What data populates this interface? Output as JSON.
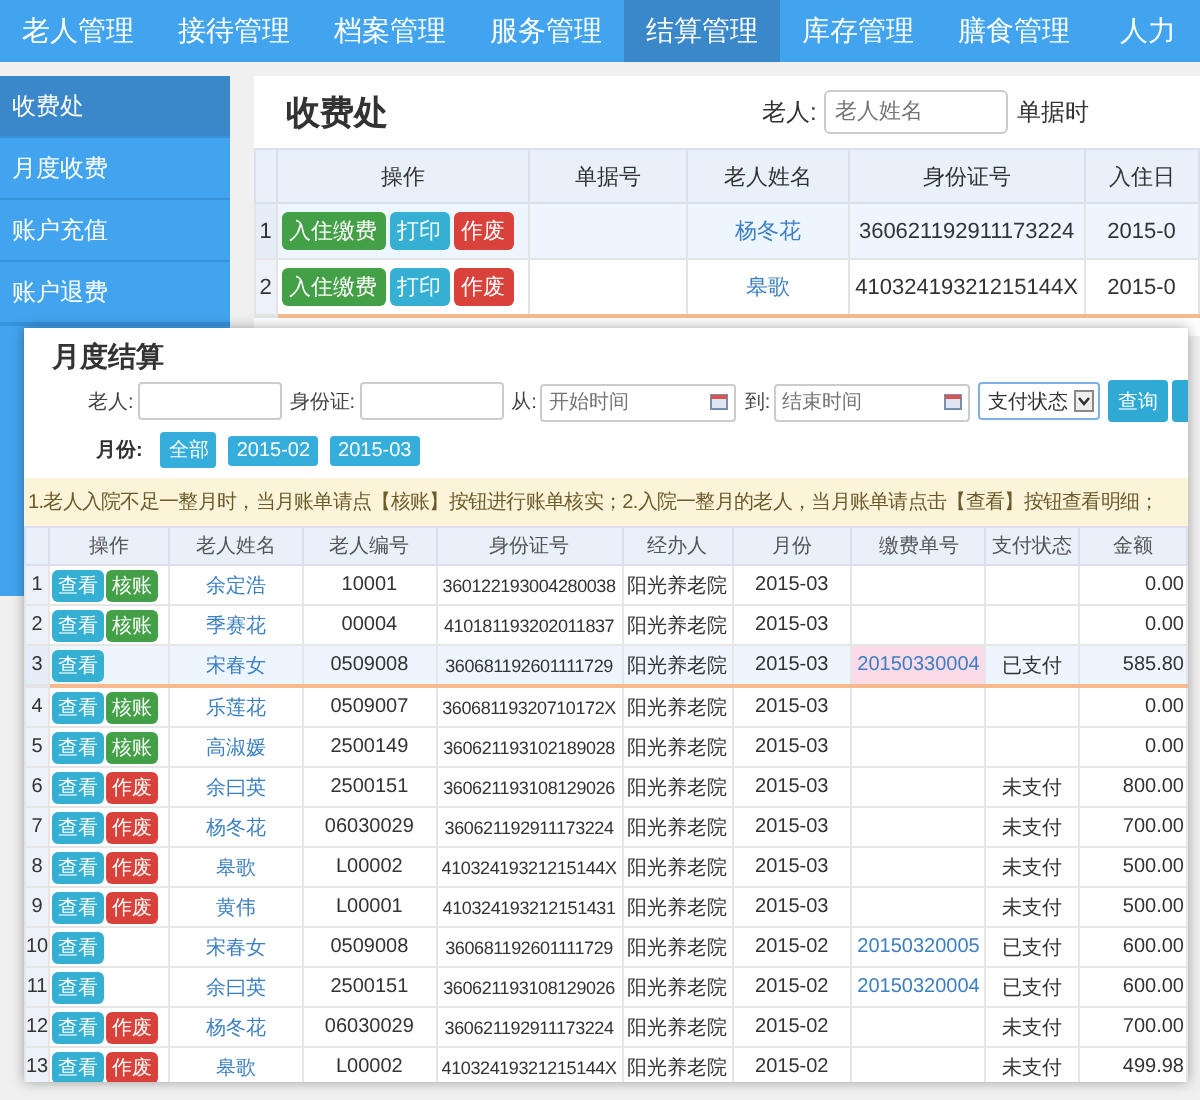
{
  "nav": [
    {
      "label": "老人管理",
      "selected": false
    },
    {
      "label": "接待管理",
      "selected": false
    },
    {
      "label": "档案管理",
      "selected": false
    },
    {
      "label": "服务管理",
      "selected": false
    },
    {
      "label": "结算管理",
      "selected": true
    },
    {
      "label": "库存管理",
      "selected": false
    },
    {
      "label": "膳食管理",
      "selected": false
    },
    {
      "label": "人力",
      "selected": false
    }
  ],
  "sidebar": [
    {
      "label": "收费处",
      "selected": true
    },
    {
      "label": "月度收费",
      "selected": false
    },
    {
      "label": "账户充值",
      "selected": false
    },
    {
      "label": "账户退费",
      "selected": false
    }
  ],
  "main": {
    "title": "收费处",
    "filter_label": "老人:",
    "filter_placeholder": "老人姓名",
    "filter_label_2": "单据时",
    "columns": [
      "操作",
      "单据号",
      "老人姓名",
      "身份证号",
      "入住日"
    ],
    "rows": [
      {
        "index": "1",
        "actions": [
          {
            "kind": "checkin",
            "label": "入住缴费"
          },
          {
            "kind": "print",
            "label": "打印"
          },
          {
            "kind": "void",
            "label": "作废"
          }
        ],
        "name": "杨冬花",
        "id_number": "360621192911173224",
        "date": "2015-0",
        "selected": true,
        "hovered": false
      },
      {
        "index": "2",
        "actions": [
          {
            "kind": "checkin",
            "label": "入住缴费"
          },
          {
            "kind": "print",
            "label": "打印"
          },
          {
            "kind": "void",
            "label": "作废"
          }
        ],
        "name": "皋歌",
        "id_number": "41032419321215144X",
        "date": "2015-0",
        "selected": false,
        "hovered": true
      }
    ]
  },
  "dialog": {
    "title": "月度结算",
    "elder_label": "老人:",
    "id_label": "身份证:",
    "from_label": "从:",
    "from_placeholder": "开始时间",
    "to_label": "到:",
    "to_placeholder": "结束时间",
    "status_select": "支付状态",
    "query_button": "查询",
    "month_label": "月份:",
    "months": [
      {
        "label": "全部"
      },
      {
        "label": "2015-02"
      },
      {
        "label": "2015-03"
      }
    ],
    "notice": "1.老人入院不足一整月时，当月账单请点【核账】按钮进行账单核实；2.入院一整月的老人，当月账单请点击【查看】按钮查看明细；",
    "columns": [
      "操作",
      "老人姓名",
      "老人编号",
      "身份证号",
      "经办人",
      "月份",
      "缴费单号",
      "支付状态",
      "金额"
    ],
    "rows": [
      {
        "index": "1",
        "actions": [
          {
            "kind": "view",
            "label": "查看"
          },
          {
            "kind": "check",
            "label": "核账"
          }
        ],
        "name": "余定浩",
        "elder_no": "10001",
        "id_number": "360122193004280038",
        "handler": "阳光养老院",
        "month": "2015-03",
        "amount": "0.00",
        "selected": false,
        "hovered": false,
        "receipt_highlighted": false
      },
      {
        "index": "2",
        "actions": [
          {
            "kind": "view",
            "label": "查看"
          },
          {
            "kind": "check",
            "label": "核账"
          }
        ],
        "name": "季赛花",
        "elder_no": "00004",
        "id_number": "410181193202011837",
        "handler": "阳光养老院",
        "month": "2015-03",
        "amount": "0.00",
        "selected": false,
        "hovered": false,
        "receipt_highlighted": false
      },
      {
        "index": "3",
        "actions": [
          {
            "kind": "view",
            "label": "查看"
          }
        ],
        "name": "宋春女",
        "elder_no": "0509008",
        "id_number": "360681192601111729",
        "handler": "阳光养老院",
        "month": "2015-03",
        "receipt": "20150330004",
        "status": "已支付",
        "amount": "585.80",
        "selected": true,
        "hovered": true,
        "receipt_highlighted": true
      },
      {
        "index": "4",
        "actions": [
          {
            "kind": "view",
            "label": "查看"
          },
          {
            "kind": "check",
            "label": "核账"
          }
        ],
        "name": "乐莲花",
        "elder_no": "0509007",
        "id_number": "36068119320710172X",
        "handler": "阳光养老院",
        "month": "2015-03",
        "amount": "0.00",
        "selected": false,
        "hovered": false,
        "receipt_highlighted": false
      },
      {
        "index": "5",
        "actions": [
          {
            "kind": "view",
            "label": "查看"
          },
          {
            "kind": "check",
            "label": "核账"
          }
        ],
        "name": "高淑媛",
        "elder_no": "2500149",
        "id_number": "360621193102189028",
        "handler": "阳光养老院",
        "month": "2015-03",
        "amount": "0.00",
        "selected": false,
        "hovered": false,
        "receipt_highlighted": false
      },
      {
        "index": "6",
        "actions": [
          {
            "kind": "view",
            "label": "查看"
          },
          {
            "kind": "void",
            "label": "作废"
          }
        ],
        "name": "余曰英",
        "elder_no": "2500151",
        "id_number": "360621193108129026",
        "handler": "阳光养老院",
        "month": "2015-03",
        "status": "未支付",
        "amount": "800.00",
        "selected": false,
        "hovered": false,
        "receipt_highlighted": false
      },
      {
        "index": "7",
        "actions": [
          {
            "kind": "view",
            "label": "查看"
          },
          {
            "kind": "void",
            "label": "作废"
          }
        ],
        "name": "杨冬花",
        "elder_no": "06030029",
        "id_number": "360621192911173224",
        "handler": "阳光养老院",
        "month": "2015-03",
        "status": "未支付",
        "amount": "700.00",
        "selected": false,
        "hovered": false,
        "receipt_highlighted": false
      },
      {
        "index": "8",
        "actions": [
          {
            "kind": "view",
            "label": "查看"
          },
          {
            "kind": "void",
            "label": "作废"
          }
        ],
        "name": "皋歌",
        "elder_no": "L00002",
        "id_number": "41032419321215144X",
        "handler": "阳光养老院",
        "month": "2015-03",
        "status": "未支付",
        "amount": "500.00",
        "selected": false,
        "hovered": false,
        "receipt_highlighted": false
      },
      {
        "index": "9",
        "actions": [
          {
            "kind": "view",
            "label": "查看"
          },
          {
            "kind": "void",
            "label": "作废"
          }
        ],
        "name": "黄伟",
        "elder_no": "L00001",
        "id_number": "410324193212151431",
        "handler": "阳光养老院",
        "month": "2015-03",
        "status": "未支付",
        "amount": "500.00",
        "selected": false,
        "hovered": false,
        "receipt_highlighted": false
      },
      {
        "index": "10",
        "actions": [
          {
            "kind": "view",
            "label": "查看"
          }
        ],
        "name": "宋春女",
        "elder_no": "0509008",
        "id_number": "360681192601111729",
        "handler": "阳光养老院",
        "month": "2015-02",
        "receipt": "20150320005",
        "status": "已支付",
        "amount": "600.00",
        "selected": false,
        "hovered": false,
        "receipt_highlighted": false
      },
      {
        "index": "11",
        "actions": [
          {
            "kind": "view",
            "label": "查看"
          }
        ],
        "name": "余曰英",
        "elder_no": "2500151",
        "id_number": "360621193108129026",
        "handler": "阳光养老院",
        "month": "2015-02",
        "receipt": "20150320004",
        "status": "已支付",
        "amount": "600.00",
        "selected": false,
        "hovered": false,
        "receipt_highlighted": false
      },
      {
        "index": "12",
        "actions": [
          {
            "kind": "view",
            "label": "查看"
          },
          {
            "kind": "void",
            "label": "作废"
          }
        ],
        "name": "杨冬花",
        "elder_no": "06030029",
        "id_number": "360621192911173224",
        "handler": "阳光养老院",
        "month": "2015-02",
        "status": "未支付",
        "amount": "700.00",
        "selected": false,
        "hovered": false,
        "receipt_highlighted": false
      },
      {
        "index": "13",
        "actions": [
          {
            "kind": "view",
            "label": "查看"
          },
          {
            "kind": "void",
            "label": "作废"
          }
        ],
        "name": "皋歌",
        "elder_no": "L00002",
        "id_number": "41032419321215144X",
        "handler": "阳光养老院",
        "month": "2015-02",
        "status": "未支付",
        "amount": "499.98",
        "selected": false,
        "hovered": false,
        "receipt_highlighted": false
      }
    ]
  }
}
